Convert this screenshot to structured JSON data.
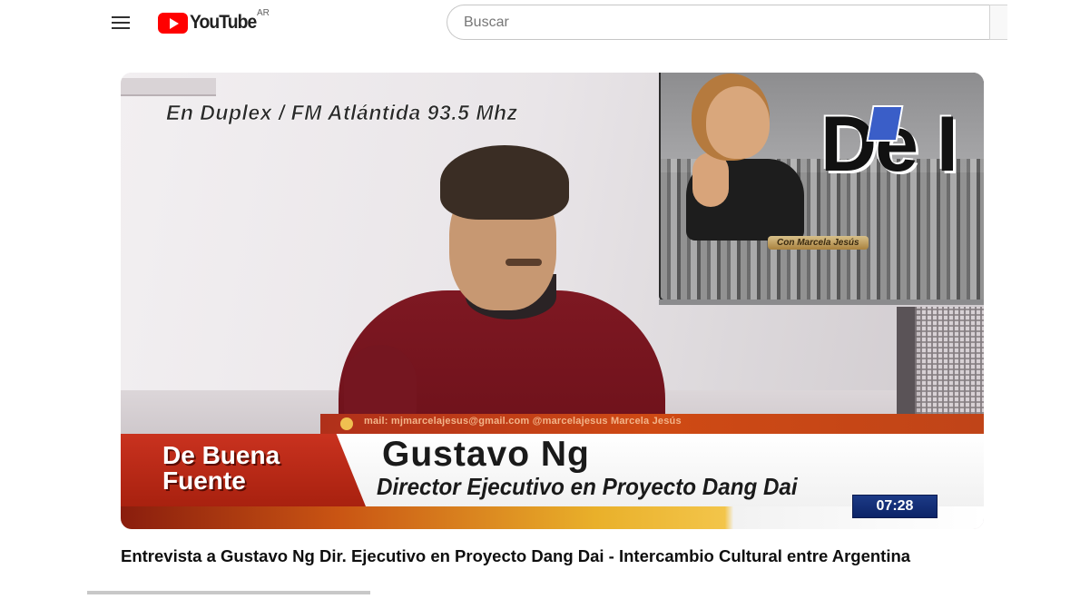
{
  "header": {
    "logo_text": "YouTube",
    "country_code": "AR",
    "search_placeholder": "Buscar"
  },
  "video": {
    "overlay_top": "En Duplex / FM Atlántida 93.5 Mhz",
    "monitor_letters": "De I",
    "monitor_tag": "Con Marcela Jesús",
    "info_bar": "mail: mjmarcelajesus@gmail.com   @marcelajesus   Marcela Jesús",
    "show_name": "De Buena Fuente",
    "guest_name": "Gustavo Ng",
    "guest_role": "Director Ejecutivo en Proyecto Dang Dai",
    "clock": "07:28"
  },
  "title": "Entrevista a Gustavo Ng Dir. Ejecutivo en Proyecto Dang Dai - Intercambio Cultural entre Argentina",
  "colors": {
    "brand_red": "#ff0000",
    "lower_third_red": "#c9321f",
    "clock_blue": "#1c3a86"
  }
}
